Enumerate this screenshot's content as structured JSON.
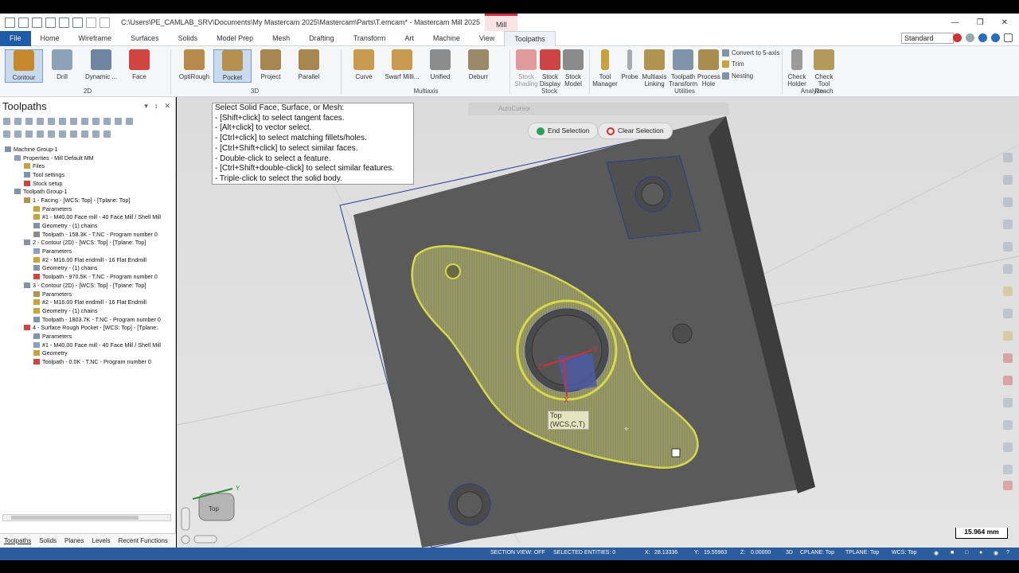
{
  "title_bar": {
    "path": "C:\\Users\\PE_CAMLAB_SRV\\Documents\\My Mastercam 2025\\Mastercam\\Parts\\T.emcam* - Mastercam Mill 2025",
    "context_tab": "Mill"
  },
  "menu": {
    "file": "File",
    "items": [
      "Home",
      "Wireframe",
      "Surfaces",
      "Solids",
      "Model Prep",
      "Mesh",
      "Drafting",
      "Transform",
      "Art",
      "Machine",
      "View",
      "Toolpaths"
    ],
    "active": "Toolpaths",
    "workspace": "Standard"
  },
  "ribbon": {
    "buttons_2d": [
      "Contour",
      "Drill",
      "Dynamic ...",
      "Face"
    ],
    "buttons_3d": [
      "OptiRough",
      "Pocket",
      "Project",
      "Parallel"
    ],
    "buttons_multiaxis": [
      "Curve",
      "Swarf Milli...",
      "Unified",
      "Deburr"
    ],
    "buttons_stock": [
      "Stock Shading",
      "Stock Display",
      "Stock Model"
    ],
    "buttons_utilities": [
      "Tool Manager",
      "Probe",
      "Multiaxis Linking",
      "Toolpath Transform",
      "Process Hole"
    ],
    "utility_small": [
      "Convert to 5-axis",
      "Trim",
      "Nesting"
    ],
    "buttons_analyze": [
      "Check Holder",
      "Check Tool Reach"
    ],
    "groups": [
      "2D",
      "3D",
      "Multiaxis",
      "Stock",
      "Utilities",
      "Analyze"
    ],
    "selected": "Pocket"
  },
  "panel": {
    "title": "Toolpaths",
    "tree": [
      {
        "indent": 0,
        "text": "Machine Group-1"
      },
      {
        "indent": 1,
        "text": "Properties - Mill Default MM"
      },
      {
        "indent": 2,
        "text": "Files"
      },
      {
        "indent": 2,
        "text": "Tool settings"
      },
      {
        "indent": 2,
        "text": "Stock setup"
      },
      {
        "indent": 1,
        "text": "Toolpath Group-1"
      },
      {
        "indent": 2,
        "text": "1 - Facing - [WCS: Top] - [Tplane: Top]"
      },
      {
        "indent": 3,
        "text": "Parameters"
      },
      {
        "indent": 3,
        "text": "#1 - M40.00 Face mill - 40 Face Mill / Shell Mill"
      },
      {
        "indent": 3,
        "text": "Geometry - (1) chains"
      },
      {
        "indent": 3,
        "text": "Toolpath - 158.3K - T.NC - Program number 0"
      },
      {
        "indent": 2,
        "text": "2 - Contour (2D) - [WCS: Top] - [Tplane: Top]"
      },
      {
        "indent": 3,
        "text": "Parameters"
      },
      {
        "indent": 3,
        "text": "#2 - M16.00 Flat endmill - 16 Flat Endmill"
      },
      {
        "indent": 3,
        "text": "Geometry - (1) chains"
      },
      {
        "indent": 3,
        "text": "Toolpath - 970.5K - T.NC - Program number 0"
      },
      {
        "indent": 2,
        "text": "3 - Contour (2D) - [WCS: Top] - [Tplane: Top]"
      },
      {
        "indent": 3,
        "text": "Parameters"
      },
      {
        "indent": 3,
        "text": "#2 - M16.00 Flat endmill - 16 Flat Endmill"
      },
      {
        "indent": 3,
        "text": "Geometry - (1) chains"
      },
      {
        "indent": 3,
        "text": "Toolpath - 1803.7K - T.NC - Program number 0"
      },
      {
        "indent": 2,
        "text": "4 - Surface Rough Pocket - [WCS: Top] - [Tplane:"
      },
      {
        "indent": 3,
        "text": "Parameters"
      },
      {
        "indent": 3,
        "text": "#1 - M40.00 Face mill - 40 Face Mill / Shell Mill"
      },
      {
        "indent": 3,
        "text": "Geometry"
      },
      {
        "indent": 3,
        "text": "Toolpath - 0.0K - T.NC - Program number 0"
      }
    ],
    "bottom_tabs": [
      "Toolpaths",
      "Solids",
      "Planes",
      "Levels",
      "Recent Functions"
    ]
  },
  "prompt": {
    "lines": [
      "Select Solid Face, Surface, or Mesh:",
      "- [Shift+click] to select tangent faces.",
      "- [Alt+click] to vector select.",
      "- [Ctrl+click] to select matching fillets/holes.",
      "- [Ctrl+Shift+click] to select similar faces.",
      "- Double-click to select a feature.",
      "- [Ctrl+Shift+double-click] to select similar features.",
      "- Triple-click to select the solid body."
    ],
    "autocursor": "AutoCursor",
    "end_selection": "End Selection",
    "clear_selection": "Clear Selection"
  },
  "viewport": {
    "plane_label_1": "Top",
    "plane_label_2": "(WCS,C,T)",
    "axis_x": "X",
    "axis_y": "Y",
    "axis_z": "Z",
    "gnomon_y": "Y",
    "cube_label": "Top",
    "scale": "15.964 mm"
  },
  "status": {
    "section_view": "SECTION VIEW: OFF",
    "selected": "SELECTED ENTITIES: 0",
    "x_label": "X:",
    "x": "28.13336",
    "y_label": "Y:",
    "y": "19.55963",
    "z_label": "Z:",
    "z": "0.00000",
    "mode": "3D",
    "cplane": "CPLANE: Top",
    "tplane": "TPLANE: Top",
    "wcs": "WCS: Top"
  },
  "colors": {
    "status_bar": "#2b5c9b",
    "file_tab": "#1e5aa8",
    "selection_highlight": "#d8d94a",
    "part_dark": "#5c5c5c"
  }
}
